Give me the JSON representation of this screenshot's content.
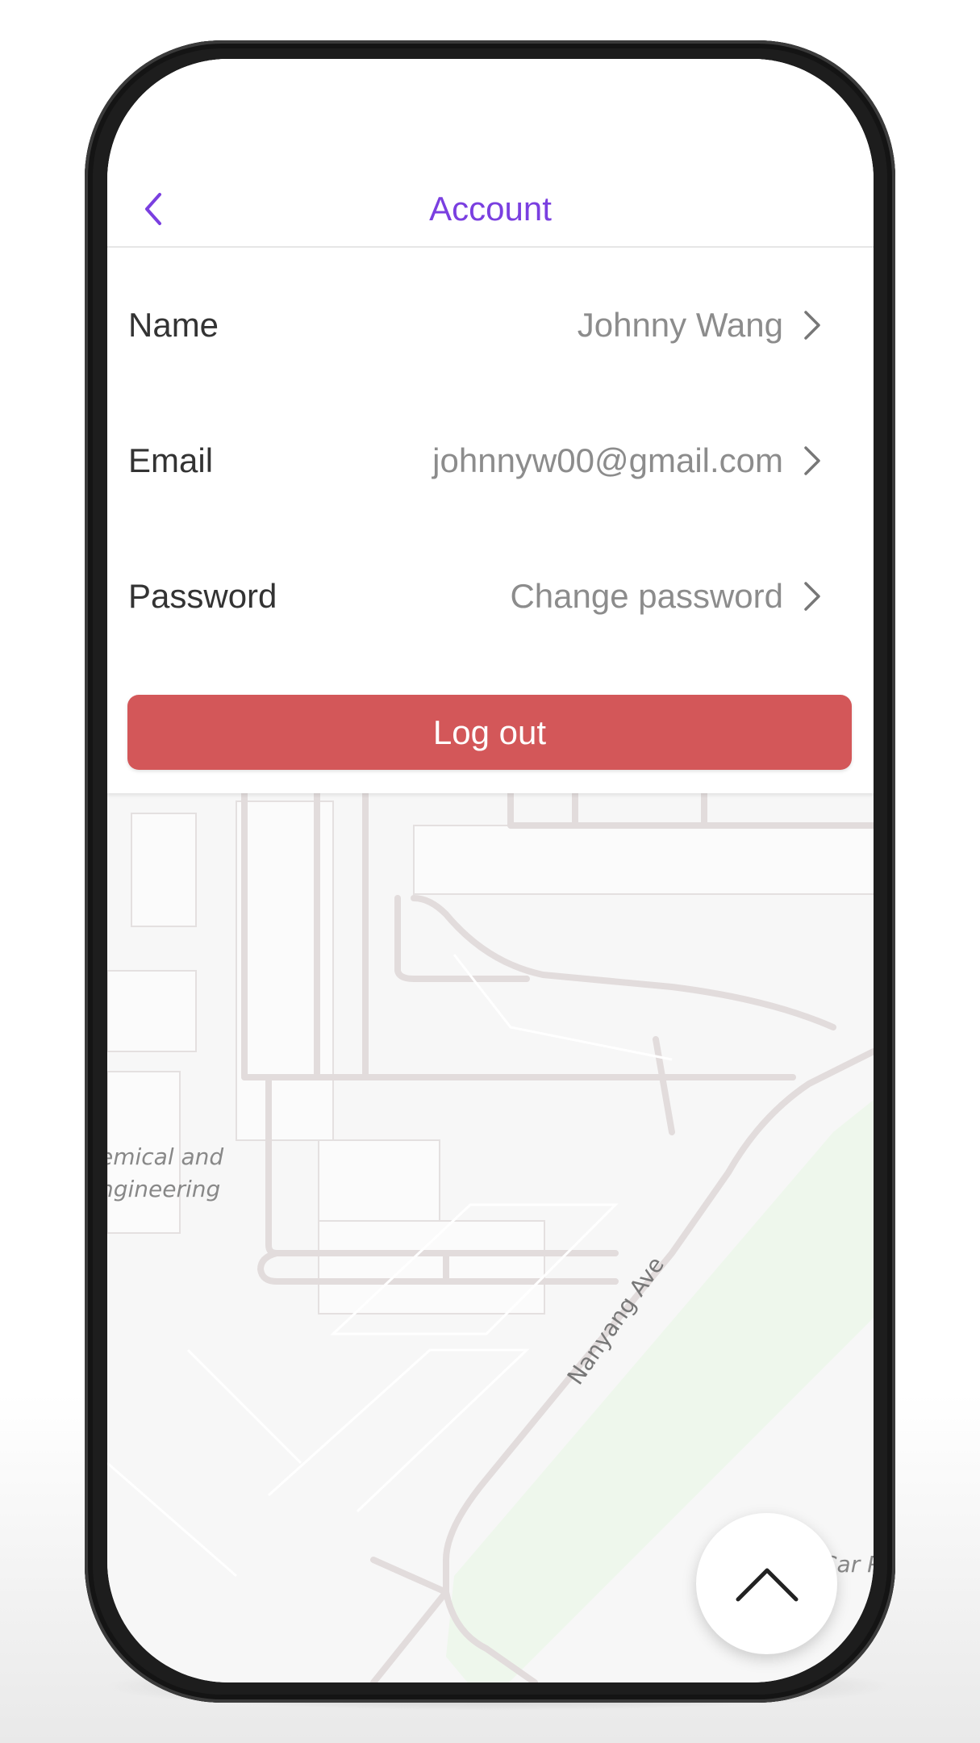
{
  "header": {
    "title": "Account",
    "back_icon": "chevron-left-icon",
    "accent_color": "#7a3fe0"
  },
  "rows": [
    {
      "label": "Name",
      "value": "Johnny Wang",
      "icon": "chevron-right-icon"
    },
    {
      "label": "Email",
      "value": "johnnyw00@gmail.com",
      "icon": "chevron-right-icon"
    },
    {
      "label": "Password",
      "value": "Change password",
      "icon": "chevron-right-icon"
    }
  ],
  "logout": {
    "label": "Log out",
    "color": "#d35759"
  },
  "map": {
    "road_label": "Nanyang Ave",
    "area_label_line1": "emical and",
    "area_label_line2": "ngineering",
    "corner_label": "Car P",
    "park_color": "#eef7ec"
  },
  "fab": {
    "icon": "chevron-up-icon"
  }
}
